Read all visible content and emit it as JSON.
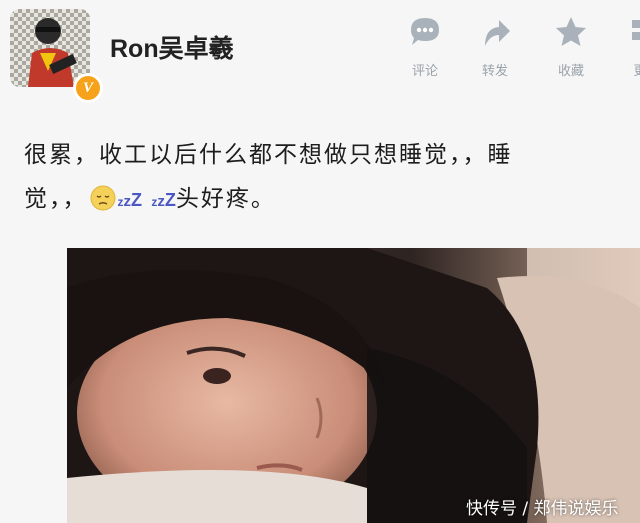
{
  "post": {
    "username": "Ron吴卓羲",
    "verified_badge": "V",
    "text_line1": "很累，收工以后什么都不想做只想睡觉，，睡",
    "text_line2_start": "觉，，",
    "zz_a": [
      "z",
      "z",
      "Z"
    ],
    "zz_b": [
      "z",
      "z",
      "Z"
    ],
    "text_line2_end": "头好疼。",
    "emoji": "pensive-face"
  },
  "actions": [
    {
      "label": "评论",
      "icon": "comment-icon"
    },
    {
      "label": "转发",
      "icon": "repost-icon"
    },
    {
      "label": "收藏",
      "icon": "star-icon"
    },
    {
      "label": "更",
      "icon": "more-icon"
    }
  ],
  "watermark": "快传号 / 郑伟说娱乐",
  "colors": {
    "accent_gray": "#9aa3ab",
    "badge": "#f7a21b",
    "zz_blue": "#4b57c2"
  }
}
